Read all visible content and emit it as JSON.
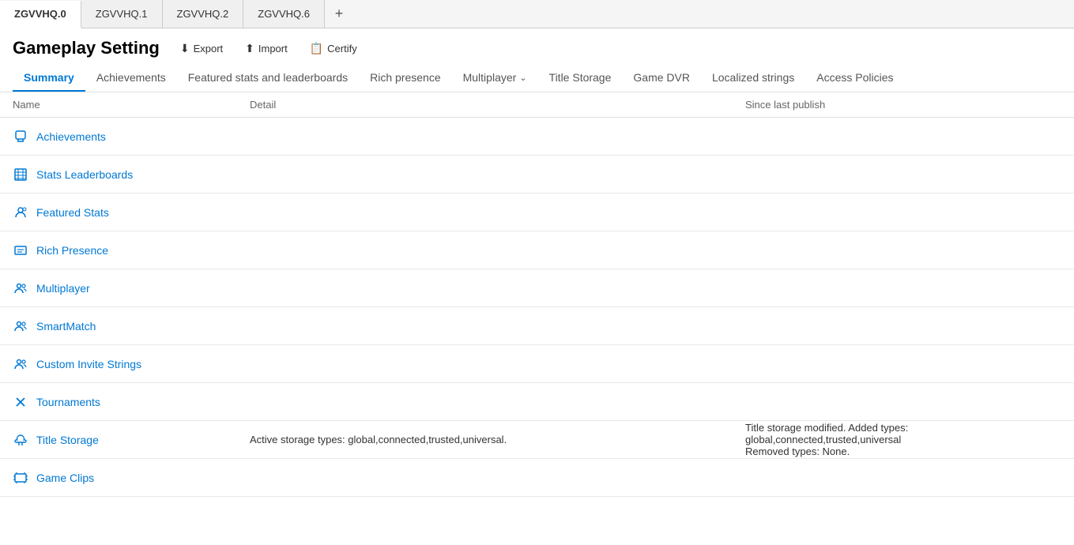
{
  "tabs": [
    {
      "id": "tab0",
      "label": "ZGVVHQ.0",
      "active": true
    },
    {
      "id": "tab1",
      "label": "ZGVVHQ.1",
      "active": false
    },
    {
      "id": "tab2",
      "label": "ZGVVHQ.2",
      "active": false
    },
    {
      "id": "tab3",
      "label": "ZGVVHQ.6",
      "active": false
    }
  ],
  "tab_add_label": "+",
  "page_title": "Gameplay Setting",
  "header_actions": {
    "export_label": "Export",
    "import_label": "Import",
    "certify_label": "Certify"
  },
  "nav_tabs": [
    {
      "id": "nav-summary",
      "label": "Summary",
      "active": true
    },
    {
      "id": "nav-achievements",
      "label": "Achievements",
      "active": false
    },
    {
      "id": "nav-featured",
      "label": "Featured stats and leaderboards",
      "active": false
    },
    {
      "id": "nav-rich",
      "label": "Rich presence",
      "active": false
    },
    {
      "id": "nav-multiplayer",
      "label": "Multiplayer",
      "active": false,
      "has_chevron": true
    },
    {
      "id": "nav-title-storage",
      "label": "Title Storage",
      "active": false
    },
    {
      "id": "nav-game-dvr",
      "label": "Game DVR",
      "active": false
    },
    {
      "id": "nav-localized",
      "label": "Localized strings",
      "active": false
    },
    {
      "id": "nav-access",
      "label": "Access Policies",
      "active": false
    }
  ],
  "table_headers": {
    "name": "Name",
    "detail": "Detail",
    "since_last_publish": "Since last publish"
  },
  "rows": [
    {
      "id": "achievements",
      "icon": "🏆",
      "icon_name": "achievements-icon",
      "name": "Achievements",
      "detail": "",
      "since": ""
    },
    {
      "id": "stats-leaderboards",
      "icon": "📊",
      "icon_name": "stats-leaderboards-icon",
      "name": "Stats Leaderboards",
      "detail": "",
      "since": ""
    },
    {
      "id": "featured-stats",
      "icon": "👤",
      "icon_name": "featured-stats-icon",
      "name": "Featured Stats",
      "detail": "",
      "since": ""
    },
    {
      "id": "rich-presence",
      "icon": "▦",
      "icon_name": "rich-presence-icon",
      "name": "Rich Presence",
      "detail": "",
      "since": ""
    },
    {
      "id": "multiplayer",
      "icon": "👥",
      "icon_name": "multiplayer-icon",
      "name": "Multiplayer",
      "detail": "",
      "since": ""
    },
    {
      "id": "smartmatch",
      "icon": "👥",
      "icon_name": "smartmatch-icon",
      "name": "SmartMatch",
      "detail": "",
      "since": ""
    },
    {
      "id": "custom-invite",
      "icon": "👥",
      "icon_name": "custom-invite-icon",
      "name": "Custom Invite Strings",
      "detail": "",
      "since": ""
    },
    {
      "id": "tournaments",
      "icon": "✕",
      "icon_name": "tournaments-icon",
      "name": "Tournaments",
      "detail": "",
      "since": ""
    },
    {
      "id": "title-storage",
      "icon": "☁",
      "icon_name": "title-storage-icon",
      "name": "Title Storage",
      "detail": "Active storage types: global,connected,trusted,universal.",
      "since_line1": "Title storage modified. Added types: global,connected,trusted,universal",
      "since_line2": "Removed types: None."
    },
    {
      "id": "game-clips",
      "icon": "🎬",
      "icon_name": "game-clips-icon",
      "name": "Game Clips",
      "detail": "",
      "since": ""
    }
  ],
  "colors": {
    "accent": "#0078d4",
    "text_muted": "#666",
    "border": "#e0e0e0"
  }
}
